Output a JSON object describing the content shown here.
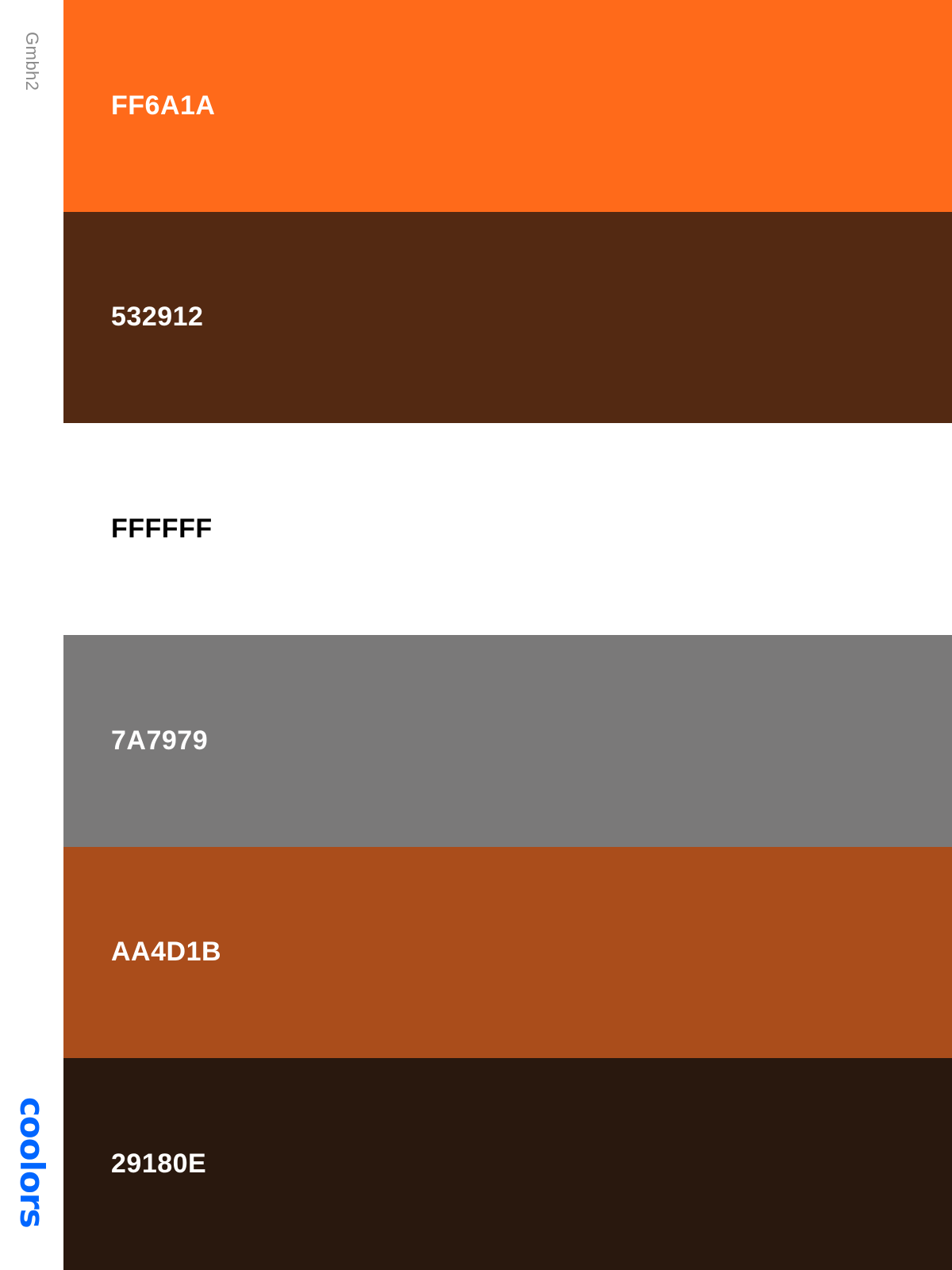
{
  "palette": {
    "name": "Gmbh2",
    "brand": "coolors",
    "brand_color": "#0066FF",
    "name_color": "#8A8A8A"
  },
  "swatches": [
    {
      "hex_label": "FF6A1A",
      "color": "#FF6A1A",
      "text_color": "#FFFFFF"
    },
    {
      "hex_label": "532912",
      "color": "#532912",
      "text_color": "#FFFFFF"
    },
    {
      "hex_label": "FFFFFF",
      "color": "#FFFFFF",
      "text_color": "#000000"
    },
    {
      "hex_label": "7A7979",
      "color": "#7A7979",
      "text_color": "#FFFFFF"
    },
    {
      "hex_label": "AA4D1B",
      "color": "#AA4D1B",
      "text_color": "#FFFFFF"
    },
    {
      "hex_label": "29180E",
      "color": "#29180E",
      "text_color": "#FFFFFF"
    }
  ]
}
